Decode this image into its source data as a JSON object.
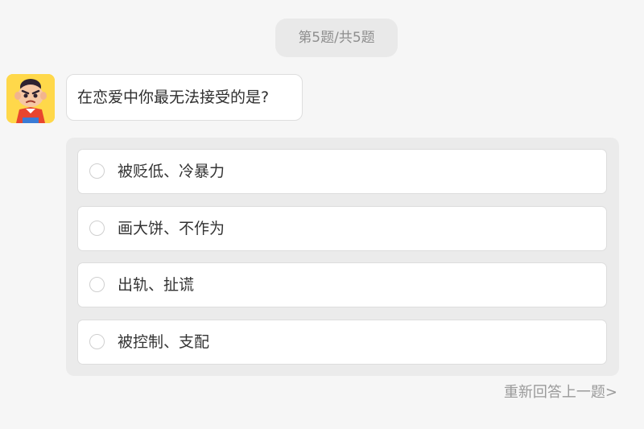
{
  "progress": {
    "label": "第5题/共5题",
    "current": 5,
    "total": 5
  },
  "question": {
    "avatar_icon": "cartoon-boy-icon",
    "text": "在恋爱中你最无法接受的是?"
  },
  "options": [
    {
      "label": "被贬低、冷暴力",
      "selected": false
    },
    {
      "label": "画大饼、不作为",
      "selected": false
    },
    {
      "label": "出轨、扯谎",
      "selected": false
    },
    {
      "label": "被控制、支配",
      "selected": false
    }
  ],
  "back_link": {
    "label": "重新回答上一题>"
  },
  "colors": {
    "background": "#f6f6f6",
    "panel": "#ebebeb",
    "avatar_bg": "#ffd84a",
    "muted_text": "#9a9a9a"
  }
}
